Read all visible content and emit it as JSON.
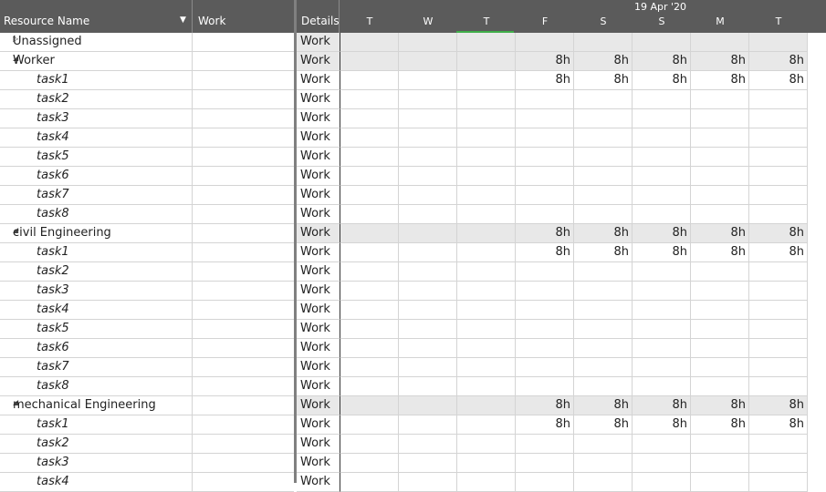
{
  "header": {
    "resource_name": "Resource Name",
    "work": "Work",
    "details": "Details",
    "date_label": "19 Apr '20",
    "days": [
      "T",
      "W",
      "T",
      "F",
      "S",
      "S",
      "M",
      "T"
    ]
  },
  "rows": [
    {
      "type": "group",
      "name": "Unassigned",
      "expanded": false,
      "detail": "Work",
      "values": [
        "",
        "",
        "",
        "",
        "",
        "",
        "",
        ""
      ]
    },
    {
      "type": "group",
      "name": "Worker",
      "expanded": true,
      "detail": "Work",
      "values": [
        "",
        "",
        "",
        "8h",
        "8h",
        "8h",
        "8h",
        "8h"
      ]
    },
    {
      "type": "task",
      "name": "task1",
      "detail": "Work",
      "values": [
        "",
        "",
        "",
        "8h",
        "8h",
        "8h",
        "8h",
        "8h"
      ]
    },
    {
      "type": "task",
      "name": "task2",
      "detail": "Work",
      "values": [
        "",
        "",
        "",
        "",
        "",
        "",
        "",
        ""
      ]
    },
    {
      "type": "task",
      "name": "task3",
      "detail": "Work",
      "values": [
        "",
        "",
        "",
        "",
        "",
        "",
        "",
        ""
      ]
    },
    {
      "type": "task",
      "name": "task4",
      "detail": "Work",
      "values": [
        "",
        "",
        "",
        "",
        "",
        "",
        "",
        ""
      ]
    },
    {
      "type": "task",
      "name": "task5",
      "detail": "Work",
      "values": [
        "",
        "",
        "",
        "",
        "",
        "",
        "",
        ""
      ]
    },
    {
      "type": "task",
      "name": "task6",
      "detail": "Work",
      "values": [
        "",
        "",
        "",
        "",
        "",
        "",
        "",
        ""
      ]
    },
    {
      "type": "task",
      "name": "task7",
      "detail": "Work",
      "values": [
        "",
        "",
        "",
        "",
        "",
        "",
        "",
        ""
      ]
    },
    {
      "type": "task",
      "name": "task8",
      "detail": "Work",
      "values": [
        "",
        "",
        "",
        "",
        "",
        "",
        "",
        ""
      ]
    },
    {
      "type": "group",
      "name": "civil Engineering",
      "expanded": true,
      "detail": "Work",
      "values": [
        "",
        "",
        "",
        "8h",
        "8h",
        "8h",
        "8h",
        "8h"
      ]
    },
    {
      "type": "task",
      "name": "task1",
      "detail": "Work",
      "values": [
        "",
        "",
        "",
        "8h",
        "8h",
        "8h",
        "8h",
        "8h"
      ]
    },
    {
      "type": "task",
      "name": "task2",
      "detail": "Work",
      "values": [
        "",
        "",
        "",
        "",
        "",
        "",
        "",
        ""
      ]
    },
    {
      "type": "task",
      "name": "task3",
      "detail": "Work",
      "values": [
        "",
        "",
        "",
        "",
        "",
        "",
        "",
        ""
      ]
    },
    {
      "type": "task",
      "name": "task4",
      "detail": "Work",
      "values": [
        "",
        "",
        "",
        "",
        "",
        "",
        "",
        ""
      ]
    },
    {
      "type": "task",
      "name": "task5",
      "detail": "Work",
      "values": [
        "",
        "",
        "",
        "",
        "",
        "",
        "",
        ""
      ]
    },
    {
      "type": "task",
      "name": "task6",
      "detail": "Work",
      "values": [
        "",
        "",
        "",
        "",
        "",
        "",
        "",
        ""
      ]
    },
    {
      "type": "task",
      "name": "task7",
      "detail": "Work",
      "values": [
        "",
        "",
        "",
        "",
        "",
        "",
        "",
        ""
      ]
    },
    {
      "type": "task",
      "name": "task8",
      "detail": "Work",
      "values": [
        "",
        "",
        "",
        "",
        "",
        "",
        "",
        ""
      ]
    },
    {
      "type": "group",
      "name": "mechanical  Engineering",
      "expanded": true,
      "detail": "Work",
      "values": [
        "",
        "",
        "",
        "8h",
        "8h",
        "8h",
        "8h",
        "8h"
      ]
    },
    {
      "type": "task",
      "name": "task1",
      "detail": "Work",
      "values": [
        "",
        "",
        "",
        "8h",
        "8h",
        "8h",
        "8h",
        "8h"
      ]
    },
    {
      "type": "task",
      "name": "task2",
      "detail": "Work",
      "values": [
        "",
        "",
        "",
        "",
        "",
        "",
        "",
        ""
      ]
    },
    {
      "type": "task",
      "name": "task3",
      "detail": "Work",
      "values": [
        "",
        "",
        "",
        "",
        "",
        "",
        "",
        ""
      ]
    },
    {
      "type": "task",
      "name": "task4",
      "detail": "Work",
      "values": [
        "",
        "",
        "",
        "",
        "",
        "",
        "",
        ""
      ]
    }
  ]
}
